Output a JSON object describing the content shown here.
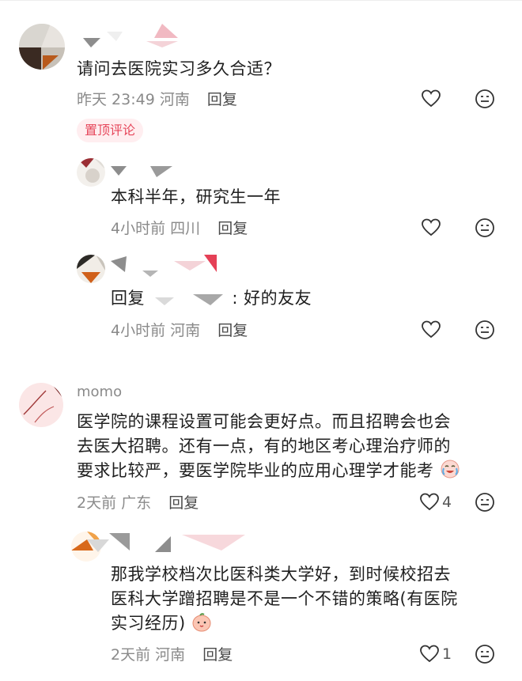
{
  "comments": [
    {
      "text": "请问去医院实习多久合适？",
      "time": "昨天 23:49",
      "location": "河南",
      "reply_label": "回复",
      "pinned_label": "置顶评论"
    },
    {
      "text": "本科半年，研究生一年",
      "time": "4小时前",
      "location": "四川",
      "reply_label": "回复"
    },
    {
      "text_prefix": "回复",
      "text_suffix": ":  好的友友",
      "time": "4小时前",
      "location": "河南",
      "reply_label": "回复"
    },
    {
      "username": "momo",
      "lines": [
        "医学院的课程设置可能会更好点。而且招聘会也会",
        "去医大招聘。还有一点，有的地区考心理治疗师的",
        "要求比较严，要医学院毕业的应用心理学才能考"
      ],
      "time": "2天前",
      "location": "广东",
      "reply_label": "回复",
      "like_count": "4"
    },
    {
      "lines": [
        "那我学校档次比医科类大学好，到时候校招去",
        "医科大学蹭招聘是不是一个不错的策略(有医院",
        "实习经历)"
      ],
      "time": "2天前",
      "location": "河南",
      "reply_label": "回复",
      "like_count": "1"
    }
  ],
  "colors": {
    "text": "#1f1f1f",
    "meta": "#8a8a8a",
    "pin_bg": "#ffeef0",
    "pin_text": "#e6465a"
  },
  "icons": [
    "heart-icon",
    "emoji-face-icon",
    "crying-laugh-emoji",
    "peach-emoji"
  ]
}
